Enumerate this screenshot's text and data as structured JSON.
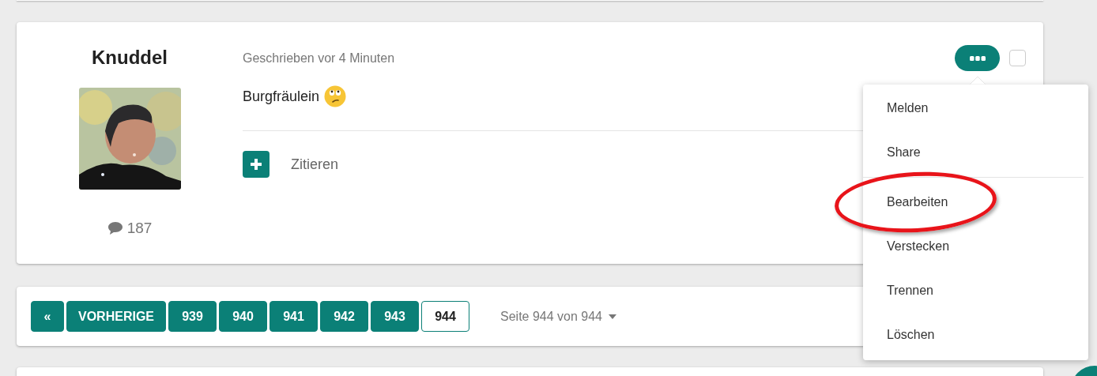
{
  "post": {
    "author": "Knuddel",
    "post_count": "187",
    "timestamp": "Geschrieben vor 4 Minuten",
    "body": "Burgfräulein",
    "quote_label": "Zitieren",
    "menu_open": true,
    "select_checked": false
  },
  "menu": {
    "sections": [
      [
        {
          "label": "Melden",
          "highlighted": false
        },
        {
          "label": "Share",
          "highlighted": false
        }
      ],
      [
        {
          "label": "Bearbeiten",
          "highlighted": true
        },
        {
          "label": "Verstecken",
          "highlighted": false
        },
        {
          "label": "Trennen",
          "highlighted": false
        },
        {
          "label": "Löschen",
          "highlighted": false
        }
      ]
    ]
  },
  "pagination": {
    "first": "«",
    "previous": "VORHERIGE",
    "pages": [
      {
        "label": "939",
        "selected": false
      },
      {
        "label": "940",
        "selected": false
      },
      {
        "label": "941",
        "selected": false
      },
      {
        "label": "942",
        "selected": false
      },
      {
        "label": "943",
        "selected": false
      },
      {
        "label": "944",
        "selected": true
      }
    ],
    "page_info": "Seite 944 von 944"
  }
}
